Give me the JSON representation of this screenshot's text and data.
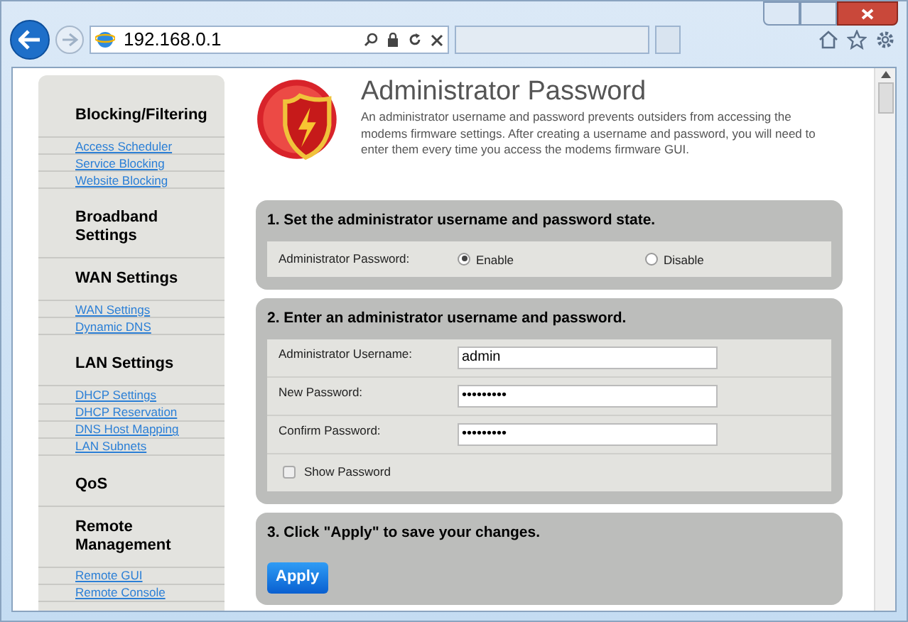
{
  "browser": {
    "address": "192.168.0.1"
  },
  "sidebar": [
    {
      "heading": "Blocking/Filtering",
      "links": [
        "Access Scheduler",
        "Service Blocking",
        "Website Blocking"
      ]
    },
    {
      "heading": "Broadband Settings"
    },
    {
      "heading": "WAN Settings",
      "links": [
        "WAN Settings",
        "Dynamic DNS"
      ]
    },
    {
      "heading": "LAN Settings",
      "links": [
        "DHCP Settings",
        "DHCP Reservation",
        "DNS Host Mapping",
        "LAN Subnets"
      ]
    },
    {
      "heading": "QoS"
    },
    {
      "heading": "Remote Management",
      "links": [
        "Remote GUI",
        "Remote Console"
      ]
    }
  ],
  "page": {
    "title": "Administrator Password",
    "description": "An administrator username and password prevents outsiders from accessing the modems firmware settings. After creating a username and password, you will need to enter them every time you access the modems firmware GUI."
  },
  "section_1": {
    "heading": "1. Set the administrator username and password state.",
    "label": "Administrator Password:",
    "options": [
      {
        "label": "Enable",
        "selected": true
      },
      {
        "label": "Disable",
        "selected": false
      }
    ]
  },
  "section_2": {
    "heading": "2. Enter an administrator username and password.",
    "fields": [
      {
        "label": "Administrator Username:",
        "value": "admin"
      },
      {
        "label": "New Password:",
        "value": "•••••••••"
      },
      {
        "label": "Confirm Password:",
        "value": "•••••••••"
      }
    ],
    "show_password": {
      "label": "Show Password",
      "checked": false
    }
  },
  "section_3": {
    "heading": "3. Click \"Apply\" to save your changes.",
    "button": "Apply"
  }
}
